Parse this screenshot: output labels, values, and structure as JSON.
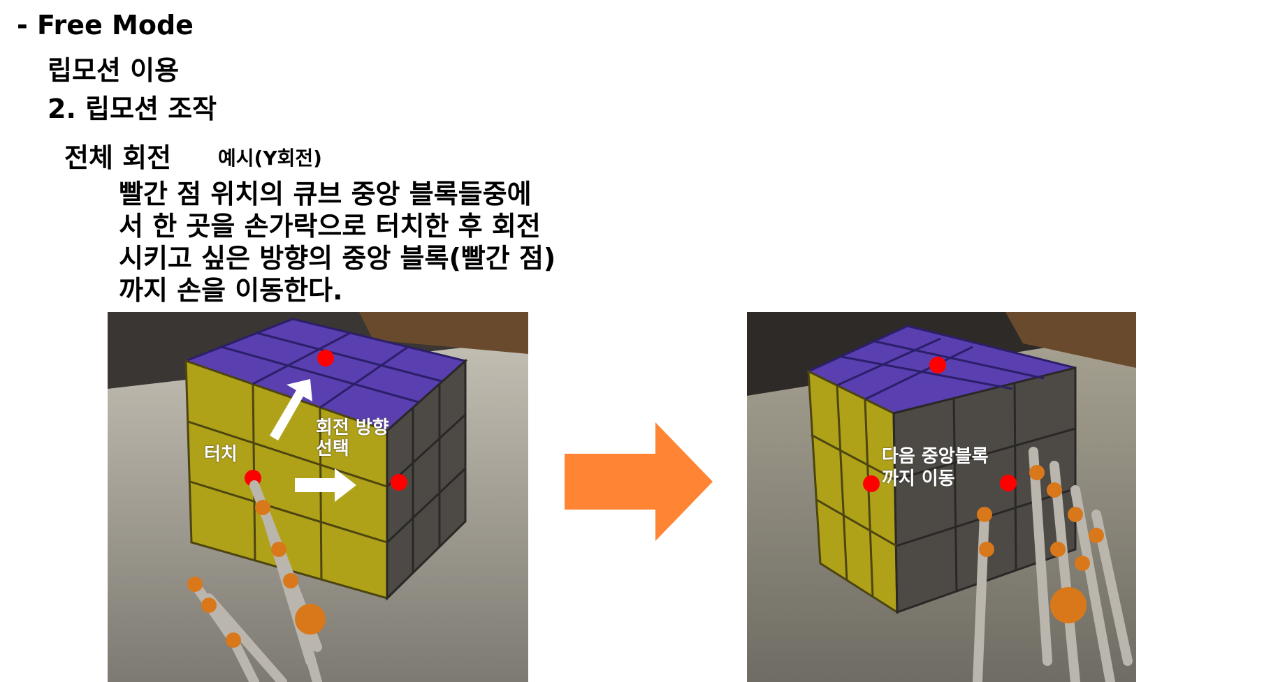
{
  "heading": {
    "mode": "- Free Mode",
    "subtitle": "립모션 이용",
    "section": "2. 립모션 조작",
    "topic": "전체 회전",
    "example": "예시(Y회전)"
  },
  "instruction": {
    "lines": [
      "빨간 점 위치의 큐브 중앙 블록들중에",
      "서 한 곳을 손가락으로 터치한 후 회전",
      "시키고 싶은 방향의 중앙 블록(빨간 점)",
      "까지 손을 이동한다."
    ]
  },
  "left_image": {
    "label_touch": "터치",
    "label_direction_line1": "회전 방향",
    "label_direction_line2": "선택"
  },
  "right_image": {
    "label_line1": "다음 중앙블록",
    "label_line2": "까지 이동"
  },
  "colors": {
    "cube_top": "#5a3fb0",
    "cube_yellow": "#b0a218",
    "cube_dark": "#4d4a46",
    "marker": "#ff0000",
    "arrow": "#ff8534"
  }
}
